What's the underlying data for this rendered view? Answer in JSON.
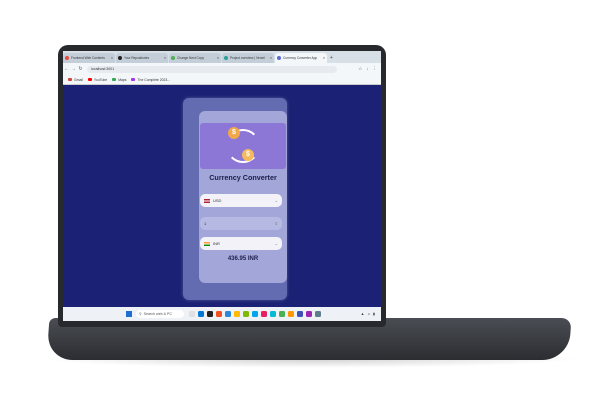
{
  "browser": {
    "tabs": [
      {
        "label": "Frontend Web Contents",
        "color": "#e84a3c",
        "active": false
      },
      {
        "label": "Your Repositories",
        "color": "#222222",
        "active": false
      },
      {
        "label": "Change Next Copy",
        "color": "#4caf50",
        "active": false
      },
      {
        "label": "Project overview | Vercel",
        "color": "#2aa198",
        "active": false
      },
      {
        "label": "Currency Converter App",
        "color": "#5b6bd6",
        "active": true
      }
    ],
    "new_tab_icon": "plus-icon",
    "url": "localhost:3001",
    "bookmarks": [
      {
        "label": "Gmail",
        "color": "#d44638"
      },
      {
        "label": "YouTube",
        "color": "#ff0000"
      },
      {
        "label": "Maps",
        "color": "#34a853"
      },
      {
        "label": "The Complete 2023...",
        "color": "#a435f0"
      }
    ]
  },
  "app": {
    "title": "Currency Converter",
    "from_currency": "USD",
    "amount": "1",
    "to_currency": "INR",
    "result": "436.95 INR",
    "coin_top_symbol": "$",
    "coin_bottom_symbol": "$",
    "colors": {
      "page_bg": "#1b2275",
      "hero": "#8c77d6",
      "coin": "#f0a84a"
    }
  },
  "taskbar": {
    "search_placeholder": "Search web & PC",
    "apps": [
      "#e0e0e0",
      "#0078d4",
      "#222222",
      "#f25022",
      "#2b88d8",
      "#ffb900",
      "#7fba00",
      "#00a4ef",
      "#e91e63",
      "#00bcd4",
      "#4caf50",
      "#ff9800",
      "#3f51b5",
      "#9c27b0",
      "#607d8b"
    ],
    "tray_icons": [
      "wifi-icon",
      "speaker-icon",
      "battery-icon"
    ]
  }
}
